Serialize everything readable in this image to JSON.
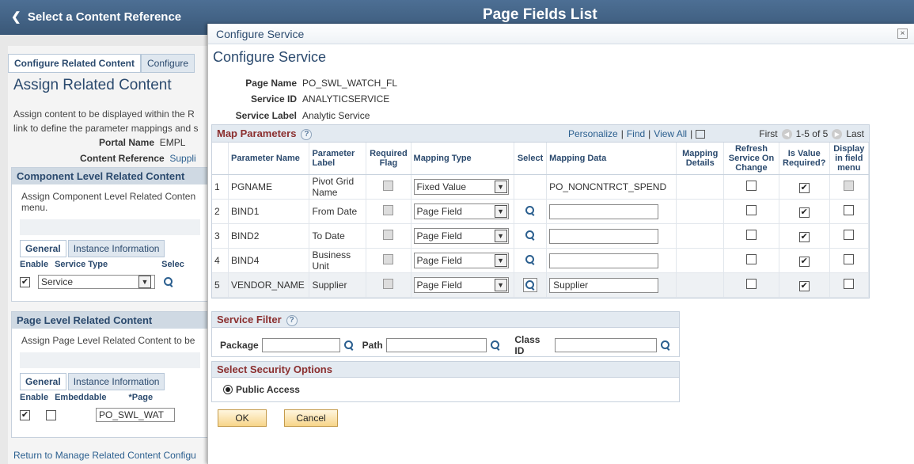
{
  "background": {
    "back_label": "Select a Content Reference",
    "page_title": "Page Fields List",
    "tabs": [
      "Configure Related Content",
      "Configure"
    ],
    "assign_title": "Assign Related Content",
    "desc_line1": "Assign content to be displayed within the R",
    "desc_line2": "link to define the parameter mappings and s",
    "portal_label": "Portal Name",
    "portal_value": "EMPL",
    "content_ref_label": "Content Reference",
    "content_ref_value": "Suppli",
    "component_section": {
      "title": "Component Level Related Content",
      "text": "Assign Component Level Related Conten menu.",
      "tabs": [
        "General",
        "Instance Information"
      ],
      "col_enable": "Enable",
      "col_type": "Service Type",
      "col_select": "Selec",
      "service_type_value": "Service"
    },
    "page_section": {
      "title": "Page Level Related Content",
      "text": "Assign Page Level Related Content to be",
      "tabs": [
        "General",
        "Instance Information"
      ],
      "col_enable": "Enable",
      "col_embeddable": "Embeddable",
      "col_page": "*Page",
      "page_value": "PO_SWL_WAT"
    },
    "return_link": "Return to Manage Related Content Configu"
  },
  "modal": {
    "titlebar": "Configure Service",
    "heading": "Configure Service",
    "close": "×",
    "page_name_label": "Page Name",
    "page_name_value": "PO_SWL_WATCH_FL",
    "service_id_label": "Service ID",
    "service_id_value": "ANALYTICSERVICE",
    "service_label_label": "Service Label",
    "service_label_value": "Analytic Service",
    "map": {
      "title": "Map Parameters",
      "personalize": "Personalize",
      "find": "Find",
      "view_all": "View All",
      "first": "First",
      "range": "1-5 of 5",
      "last": "Last",
      "columns": {
        "param_name": "Parameter Name",
        "param_label": "Parameter Label",
        "required": "Required Flag",
        "mapping_type": "Mapping Type",
        "select": "Select",
        "mapping_data": "Mapping Data",
        "mapping_details": "Mapping Details",
        "refresh": "Refresh Service On Change",
        "is_value_required": "Is Value Required?",
        "display_in_field": "Display in field menu"
      },
      "rows": [
        {
          "num": "1",
          "name": "PGNAME",
          "label": "Pivot Grid Name",
          "type": "Fixed Value",
          "data": "PO_NONCNTRCT_SPEND",
          "value_required": "✔"
        },
        {
          "num": "2",
          "name": "BIND1",
          "label": "From Date",
          "type": "Page Field",
          "data": "",
          "value_required": "✔"
        },
        {
          "num": "3",
          "name": "BIND2",
          "label": "To Date",
          "type": "Page Field",
          "data": "",
          "value_required": "✔"
        },
        {
          "num": "4",
          "name": "BIND4",
          "label": "Business Unit",
          "type": "Page Field",
          "data": "",
          "value_required": "✔"
        },
        {
          "num": "5",
          "name": "VENDOR_NAME",
          "label": "Supplier",
          "type": "Page Field",
          "data": "Supplier",
          "value_required": "✔"
        }
      ]
    },
    "filter": {
      "title": "Service Filter",
      "package_label": "Package",
      "path_label": "Path",
      "class_label": "Class ID"
    },
    "security": {
      "title": "Select Security Options",
      "public_access": "Public Access"
    },
    "ok_label": "OK",
    "cancel_label": "Cancel"
  }
}
